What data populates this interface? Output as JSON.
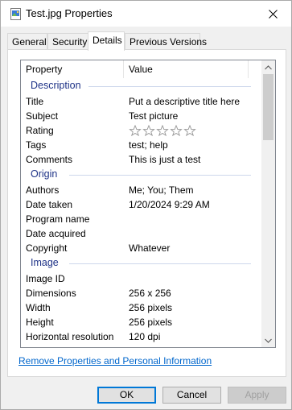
{
  "window": {
    "title": "Test.jpg Properties"
  },
  "tabs": [
    {
      "label": "General"
    },
    {
      "label": "Security"
    },
    {
      "label": "Details"
    },
    {
      "label": "Previous Versions"
    }
  ],
  "list": {
    "col_property": "Property",
    "col_value": "Value",
    "groups": {
      "description": "Description",
      "origin": "Origin",
      "image": "Image"
    },
    "description_rows": [
      {
        "p": "Title",
        "v": "Put a descriptive title here"
      },
      {
        "p": "Subject",
        "v": "Test picture"
      },
      {
        "p": "Rating",
        "v": ""
      },
      {
        "p": "Tags",
        "v": "test; help"
      },
      {
        "p": "Comments",
        "v": "This is just a test"
      }
    ],
    "rating_stars": 0,
    "origin_rows": [
      {
        "p": "Authors",
        "v": "Me; You; Them"
      },
      {
        "p": "Date taken",
        "v": "1/20/2024 9:29 AM"
      },
      {
        "p": "Program name",
        "v": ""
      },
      {
        "p": "Date acquired",
        "v": ""
      },
      {
        "p": "Copyright",
        "v": "Whatever"
      }
    ],
    "image_rows": [
      {
        "p": "Image ID",
        "v": ""
      },
      {
        "p": "Dimensions",
        "v": "256 x 256"
      },
      {
        "p": "Width",
        "v": "256 pixels"
      },
      {
        "p": "Height",
        "v": "256 pixels"
      },
      {
        "p": "Horizontal resolution",
        "v": "120 dpi"
      }
    ]
  },
  "link_text": "Remove Properties and Personal Information",
  "buttons": {
    "ok": "OK",
    "cancel": "Cancel",
    "apply": "Apply"
  },
  "colors": {
    "group_heading": "#1e3287",
    "link": "#0066cc",
    "default_button_border": "#0078d7"
  }
}
